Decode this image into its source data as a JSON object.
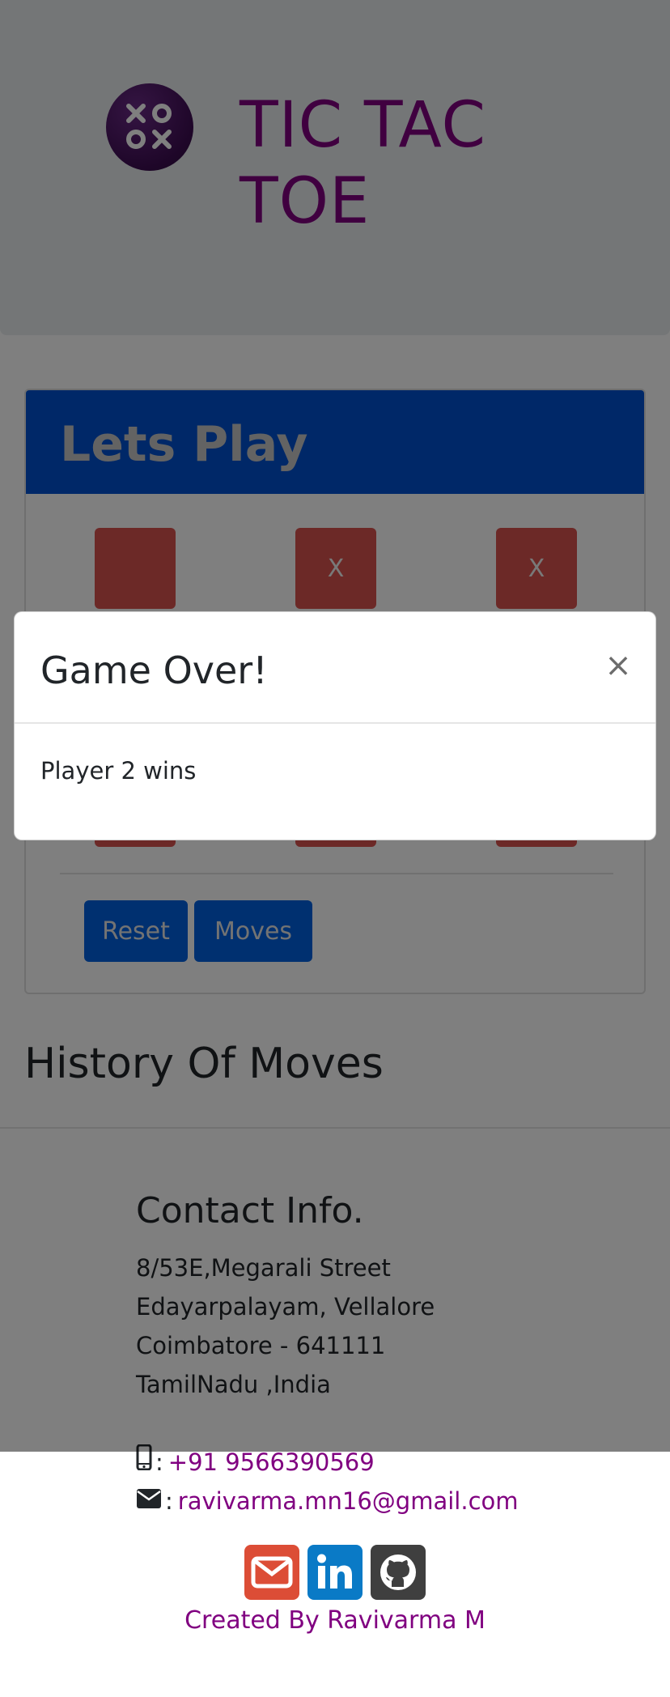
{
  "header": {
    "title": "TIC TAC TOE",
    "logo_icon": "xoxo-logo-icon"
  },
  "game": {
    "card_title": "Lets Play",
    "board": [
      "",
      "X",
      "X",
      "",
      "",
      "",
      "",
      "",
      ""
    ],
    "buttons": {
      "reset": "Reset",
      "moves": "Moves"
    }
  },
  "history": {
    "title": "History Of Moves"
  },
  "contact": {
    "title": "Contact Info.",
    "address": [
      "8/53E,Megarali Street",
      "Edayarpalayam, Vellalore",
      "Coimbatore - 641111",
      "TamilNadu ,India"
    ],
    "phone_sep": ":",
    "phone": "+91 9566390569",
    "email_sep": ":",
    "email": "ravivarma.mn16@gmail.com",
    "social_icons": [
      "envelope-icon",
      "linkedin-icon",
      "github-icon"
    ],
    "credit": "Created By Ravivarma M"
  },
  "modal": {
    "title": "Game Over!",
    "close": "×",
    "message": "Player 2 wins"
  },
  "colors": {
    "brand_purple": "#800080",
    "primary_blue": "#0060e0",
    "cell_red": "#d9534f",
    "backdrop": "rgba(0,0,0,0.5)"
  }
}
